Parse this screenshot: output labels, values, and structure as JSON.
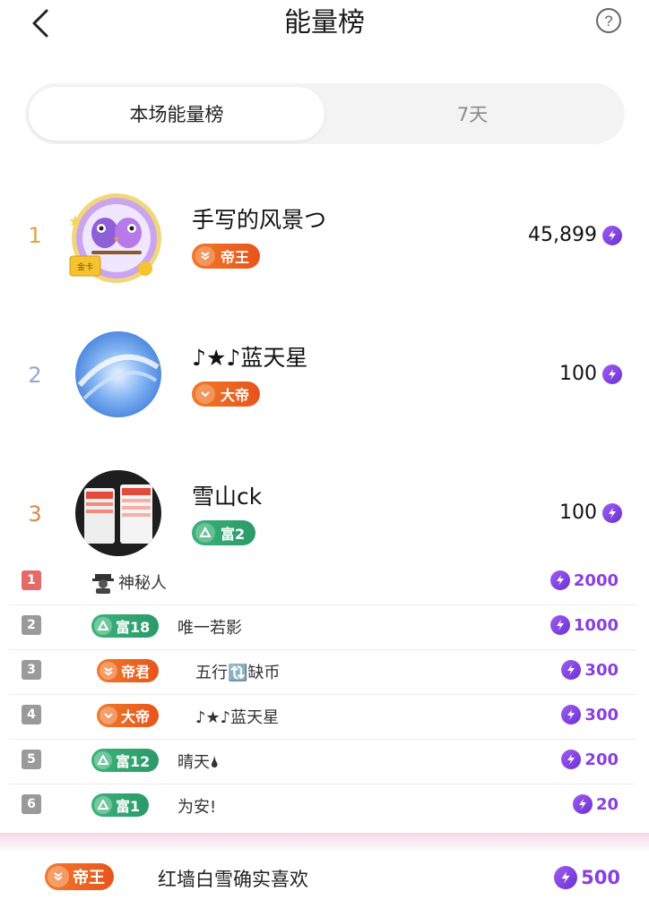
{
  "header": {
    "title": "能量榜"
  },
  "tabs": [
    {
      "label": "本场能量榜",
      "active": true
    },
    {
      "label": "7天",
      "active": false
    }
  ],
  "top3": [
    {
      "rank": "1",
      "name": "手写的风景つ",
      "score": "45,899",
      "badge": "帝王",
      "badge_type": "orange",
      "rank_color": "#e0a33a"
    },
    {
      "rank": "2",
      "name": "♪★♪蓝天星",
      "score": "100",
      "badge": "大帝",
      "badge_type": "orange",
      "rank_color": "#9aa3d8"
    },
    {
      "rank": "3",
      "name": "雪山ck",
      "score": "100",
      "badge": "富2",
      "badge_type": "green",
      "rank_color": "#d98a4a"
    }
  ],
  "list": [
    {
      "rank": "1",
      "badge": "",
      "name": "神秘人",
      "score": "2000",
      "rank_color": "#e46a6a"
    },
    {
      "rank": "2",
      "badge": "富18",
      "badge_type": "green",
      "name": "唯一若影",
      "score": "1000",
      "rank_color": "#9a9a9a"
    },
    {
      "rank": "3",
      "badge": "帝君",
      "badge_type": "orange",
      "name": "五行🔃缺币",
      "score": "300",
      "rank_color": "#9a9a9a"
    },
    {
      "rank": "4",
      "badge": "大帝",
      "badge_type": "orange",
      "name": "♪★♪蓝天星",
      "score": "300",
      "rank_color": "#9a9a9a"
    },
    {
      "rank": "5",
      "badge": "富12",
      "badge_type": "green",
      "name": "晴天🌢",
      "score": "200",
      "rank_color": "#9a9a9a"
    },
    {
      "rank": "6",
      "badge": "富1",
      "badge_type": "green",
      "name": "为安!",
      "score": "20",
      "rank_color": "#9a9a9a"
    }
  ],
  "me": {
    "badge": "帝王",
    "name": "红墙白雪确实喜欢",
    "score": "500"
  }
}
